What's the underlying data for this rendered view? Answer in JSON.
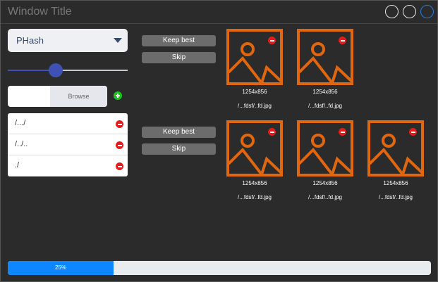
{
  "window": {
    "title": "Window Title"
  },
  "controls": {
    "algorithm_select": {
      "value": "PHash"
    },
    "threshold_slider": {
      "value_percent": 40
    },
    "browse": {
      "label": "Browse",
      "value": ""
    },
    "folders": [
      {
        "path": "/.../"
      },
      {
        "path": "/../.."
      },
      {
        "path": "./"
      }
    ]
  },
  "groups": [
    {
      "keep_best_label": "Keep best",
      "skip_label": "Skip",
      "images": [
        {
          "size": "1254x856",
          "path": "/...fdsf/..fd.jpg"
        },
        {
          "size": "1254x856",
          "path": "/...fdsf/..fd.jpg"
        }
      ]
    },
    {
      "keep_best_label": "Keep best",
      "skip_label": "Skip",
      "images": [
        {
          "size": "1254x856",
          "path": "/...fdsf/..fd.jpg"
        },
        {
          "size": "1254x856",
          "path": "/...fdsf/..fd.jpg"
        },
        {
          "size": "1254x856",
          "path": "/...fdsf/..fd.jpg"
        }
      ]
    }
  ],
  "progress": {
    "value_percent": 25,
    "label": "25%"
  },
  "colors": {
    "accent": "#3f51b5",
    "progress": "#0d86ff",
    "image_placeholder": "#e0670f",
    "remove": "#e41c1c",
    "add": "#1ec31e"
  }
}
